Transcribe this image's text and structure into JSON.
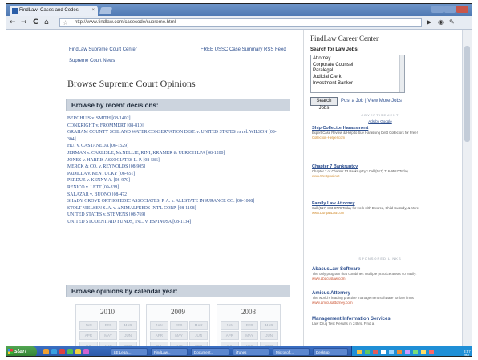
{
  "browser": {
    "tab_title": "FindLaw: Cases and Codes -",
    "tab_close": "×",
    "url": "http://www.findlaw.com/casecode/supreme.html",
    "back": "←",
    "forward": "→",
    "reload": "C",
    "home": "⌂",
    "star": "☆"
  },
  "main": {
    "link_supreme_center": "FindLaw Supreme Court Center",
    "link_supreme_news": "Supreme Court News",
    "link_rss": "FREE USSC Case Summary RSS Feed",
    "page_title": "Browse Supreme Court Opinions",
    "recent_header": "Browse by recent decisions:",
    "cases": [
      "BERGHUIS v. SMITH [08-1402]",
      "CONKRIGHT v. FROMMERT [08-810]",
      "GRAHAM COUNTY SOIL AND WATER CONSERVATION DIST. v. UNITED STATES ex rel. WILSON [08-",
      "304]",
      "HUI v. CASTANEDA [08-1529]",
      "JERMAN v. CARLISLE, McNELLIE, RINI, KRAMER & ULRICH LPA [08-1200]",
      "JONES v. HARRIS ASSOCIATES L. P. [08-586]",
      "MERCK & CO. v. REYNOLDS [08-905]",
      "PADILLA v. KENTUCKY [08-651]",
      "PERDUE v. KENNY A. [08-970]",
      "RENICO v. LETT [09-338]",
      "SALAZAR v. BUONO [08-472]",
      "SHADY GROVE ORTHOPEDIC ASSOCIATES, P. A. v. ALLSTATE INSURANCE CO. [08-1008]",
      "STOLT-NIELSEN S. A. v. ANIMALFEEDS INT'L CORP. [08-1198]",
      "UNITED STATES v. STEVENS [08-769]",
      "UNITED STUDENT AID FUNDS, INC. v. ESPINOSA [08-1134]"
    ],
    "calendar_header": "Browse opinions by calendar year:",
    "years": [
      {
        "year": "2010",
        "months": [
          "JAN",
          "FEB",
          "MAR",
          "APR",
          "MAY",
          "JUN",
          "JUL",
          "AUG",
          "SEP"
        ]
      },
      {
        "year": "2009",
        "months": [
          "JAN",
          "FEB",
          "MAR",
          "APR",
          "MAY",
          "JUN",
          "JUL",
          "AUG",
          "SEP"
        ]
      },
      {
        "year": "2008",
        "months": [
          "JAN",
          "FEB",
          "MAR",
          "APR",
          "MAY",
          "JUN",
          "JUL",
          "AUG",
          "SEP"
        ]
      }
    ]
  },
  "sidebar": {
    "career_title": "FindLaw Career Center",
    "search_label": "Search for Law Jobs:",
    "job_options": [
      "Attorney",
      "Corporate Counsel",
      "Paralegal",
      "Judicial Clerk",
      "Investment Banker"
    ],
    "search_button": "Search Jobs",
    "post_links": "Post a Job  |  View More Jobs",
    "ads_header": "ADVERTISEMENT",
    "ads_link": "Ads by Google",
    "ads": [
      {
        "title": "Ship Collector Harassment",
        "body": "Expert Case Review & Help to Sue Harassing Debt Collectors for Free!",
        "url": "Collection-Helper.com"
      },
      {
        "title": "Chapter 7 Bankruptcy",
        "body": "Chapter 7 or Chapter 13 Bankruptcy? Call (517) 716-9557 Today",
        "url": "www.Westphal.net"
      },
      {
        "title": "Family Law Attorney",
        "body": "Call (517) 803-8778 Today for Help with Divorce, Child Custody, & More",
        "url": "www.DurganLaw.com"
      }
    ],
    "sponsored_header": "SPONSORED LINKS",
    "sponsored": [
      {
        "title": "AbacusLaw Software",
        "body": "The only program that combines multiple practice areas so easily.",
        "url": "www.abacuslaw.com"
      },
      {
        "title": "Amicus Attorney",
        "body": "The world's leading practice management software for law firms",
        "url": "www.amicusattorney.com"
      },
      {
        "title": "Management Information Services",
        "body": "Law Drug Test Results in 24hrs. Find a",
        "url": ""
      }
    ]
  },
  "taskbar": {
    "start": "start",
    "buttons": [
      "LE Legal...",
      "FindLaw...",
      "Document...",
      "iTunes",
      "Microsoft...",
      "Desktop"
    ],
    "clock": "3:57 PM"
  },
  "colors": {
    "link": "#2d4f8f",
    "section_bar": "#ccd4de",
    "taskbar": "#2a55a5",
    "start": "#3b8f3b"
  }
}
